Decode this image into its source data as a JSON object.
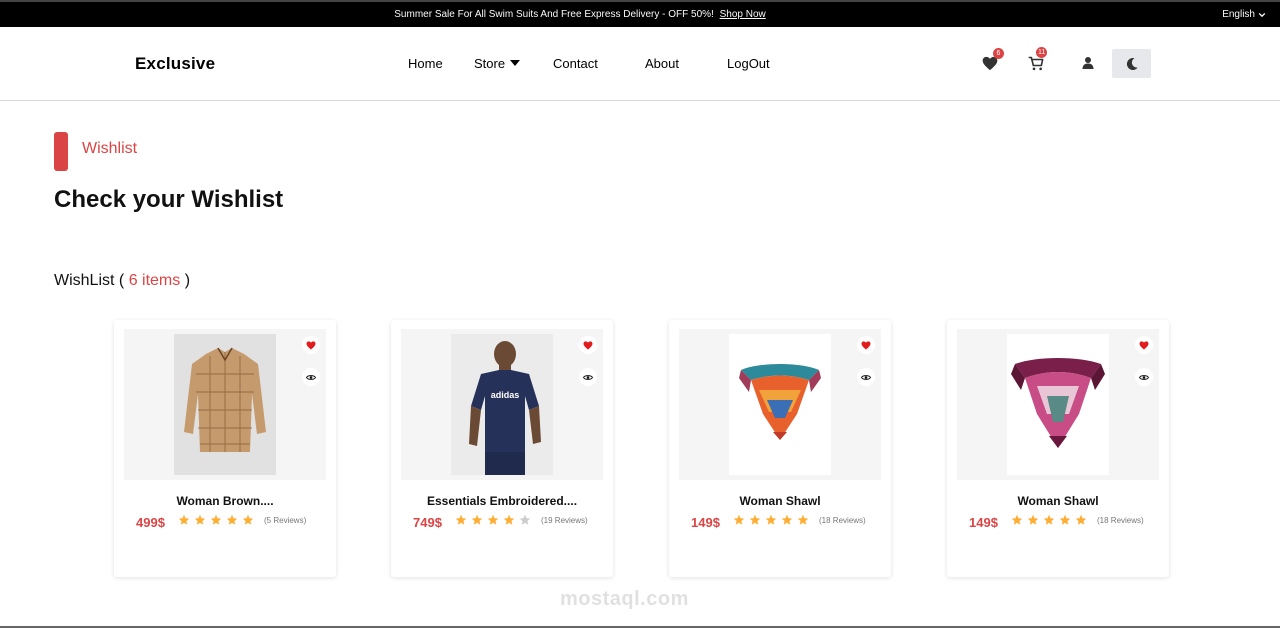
{
  "topbar": {
    "promo_text": "Summer Sale For All Swim Suits And Free Express Delivery - OFF 50%!",
    "promo_link": "Shop Now",
    "language": "English"
  },
  "header": {
    "logo": "Exclusive",
    "nav": [
      {
        "label": "Home"
      },
      {
        "label": "Store"
      },
      {
        "label": "Contact"
      },
      {
        "label": "About"
      },
      {
        "label": "LogOut"
      }
    ],
    "wishlist_count": "6",
    "cart_count": "11"
  },
  "section": {
    "label": "Wishlist",
    "title": "Check your Wishlist",
    "count_prefix": "WishList (",
    "count_text": "6 items",
    "count_suffix": ")"
  },
  "products": [
    {
      "name": "Woman Brown....",
      "price": "499$",
      "rating": 5,
      "reviews": "(5 Reviews)",
      "image": "plaid-shirt"
    },
    {
      "name": "Essentials Embroidered....",
      "price": "749$",
      "rating": 4,
      "reviews": "(19 Reviews)",
      "image": "adidas-tshirt-model"
    },
    {
      "name": "Woman Shawl",
      "price": "149$",
      "rating": 5,
      "reviews": "(18 Reviews)",
      "image": "colorful-scarf"
    },
    {
      "name": "Woman Shawl",
      "price": "149$",
      "rating": 5,
      "reviews": "(18 Reviews)",
      "image": "pink-scarf"
    }
  ],
  "watermark": "mostaql.com",
  "colors": {
    "accent": "#db4444",
    "star": "#ffad33",
    "star_empty": "#cccccc"
  }
}
